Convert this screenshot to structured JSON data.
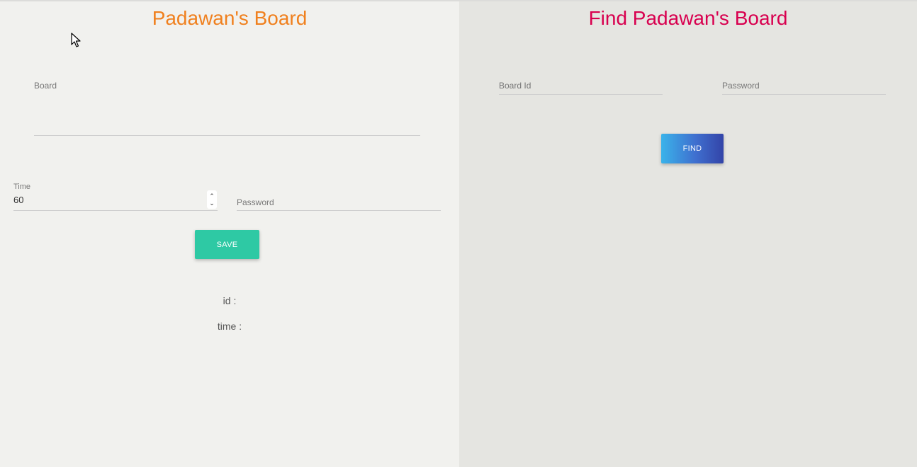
{
  "left_panel": {
    "title": "Padawan's Board",
    "board_field": {
      "label": "Board",
      "value": ""
    },
    "time_field": {
      "label": "Time",
      "value": "60"
    },
    "password_field": {
      "placeholder": "Password"
    },
    "save_button": "SAVE",
    "id_label": "id :",
    "time_label": "time :"
  },
  "right_panel": {
    "title": "Find Padawan's Board",
    "board_id_field": {
      "placeholder": "Board Id"
    },
    "password_field": {
      "placeholder": "Password"
    },
    "find_button": "FIND"
  },
  "colors": {
    "left_title": "#f0801e",
    "right_title": "#d8004f",
    "save_button": "#2ec9a4",
    "find_button_start": "#3ab3ea",
    "find_button_end": "#3344a8"
  },
  "icons": [
    "mouse-pointer-icon",
    "chevron-up-icon",
    "chevron-down-icon"
  ]
}
